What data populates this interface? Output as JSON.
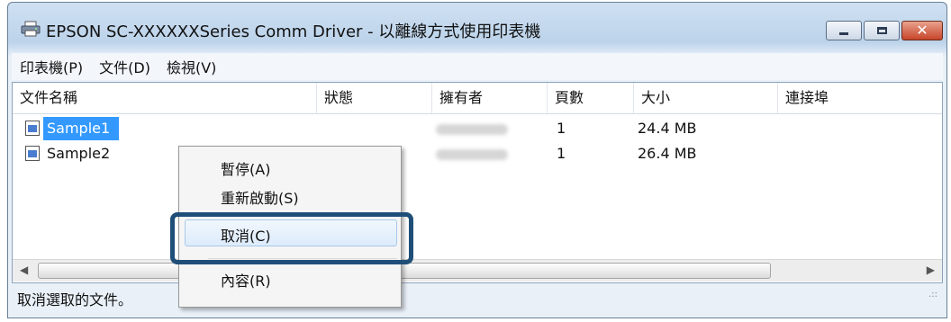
{
  "window": {
    "title": "EPSON SC-XXXXXXSeries Comm Driver - 以離線方式使用印表機",
    "icon": "printer-icon",
    "controls": {
      "minimize_icon": "minimize-icon",
      "maximize_icon": "maximize-icon",
      "close_icon": "close-icon",
      "close_glyph": "✕"
    }
  },
  "menubar": {
    "items": [
      "印表機(P)",
      "文件(D)",
      "檢視(V)"
    ]
  },
  "table": {
    "columns": [
      "文件名稱",
      "狀態",
      "擁有者",
      "頁數",
      "大小",
      "連接埠"
    ],
    "rows": [
      {
        "name": "Sample1",
        "status": "",
        "owner": "(blurred)",
        "pages": "1",
        "size": "24.4 MB",
        "port": "",
        "selected": true
      },
      {
        "name": "Sample2",
        "status": "",
        "owner": "(blurred)",
        "pages": "1",
        "size": "26.4 MB",
        "port": "",
        "selected": false
      }
    ]
  },
  "context_menu": {
    "items": [
      "暫停(A)",
      "重新啟動(S)",
      "取消(C)",
      "內容(R)"
    ],
    "highlighted": "取消(C)"
  },
  "scrollbar": {
    "left_arrow": "◀",
    "right_arrow": "▶"
  },
  "statusbar": {
    "text": "取消選取的文件。",
    "grip": ".::"
  },
  "colors": {
    "selection": "#3399ff",
    "callout": "#1f4e79",
    "menu_bg": "#f5f5f5"
  }
}
